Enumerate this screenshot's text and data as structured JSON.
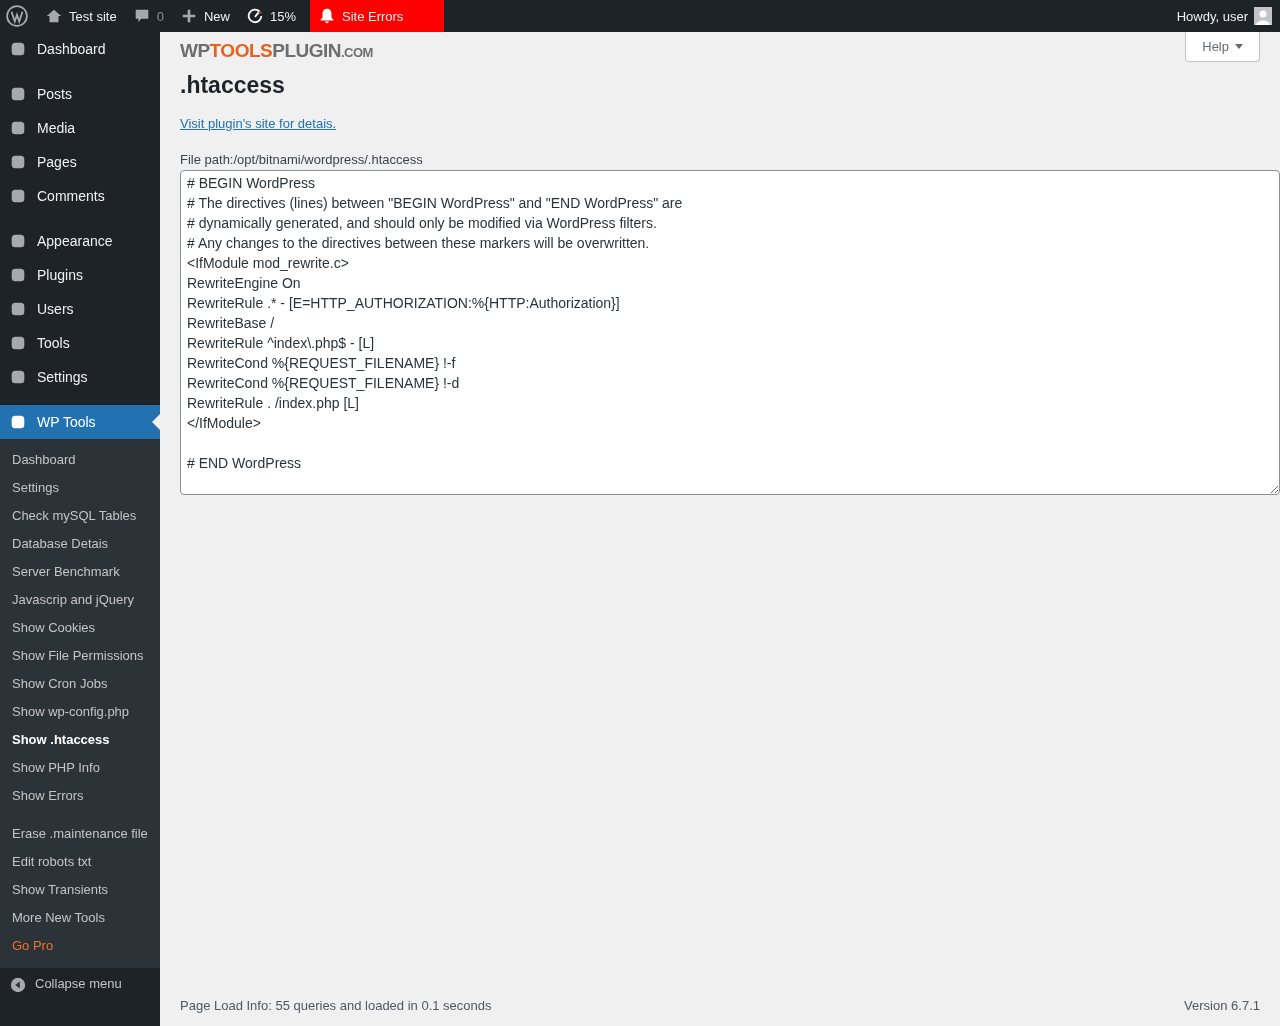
{
  "admin_bar": {
    "site": "Test site",
    "comments": "0",
    "new": "New",
    "speed": "15%",
    "alert": "Site Errors",
    "greeting": "Howdy, user"
  },
  "menu_groups": [
    {
      "items": [
        {
          "label": "Dashboard",
          "selected": false
        }
      ]
    },
    {
      "items": [
        {
          "label": "Posts",
          "selected": false
        },
        {
          "label": "Media",
          "selected": false
        },
        {
          "label": "Pages",
          "selected": false
        },
        {
          "label": "Comments",
          "selected": false
        }
      ]
    },
    {
      "items": [
        {
          "label": "Appearance",
          "selected": false
        },
        {
          "label": "Plugins",
          "selected": false
        },
        {
          "label": "Users",
          "selected": false
        },
        {
          "label": "Tools",
          "selected": false
        },
        {
          "label": "Settings",
          "selected": false
        }
      ]
    },
    {
      "items": [
        {
          "label": "WP Tools",
          "selected": true
        }
      ]
    }
  ],
  "submenu_groups": [
    {
      "items": [
        {
          "label": "Dashboard",
          "kind": "link",
          "selected": false
        },
        {
          "label": "Settings",
          "kind": "link",
          "selected": false
        },
        {
          "label": "Check mySQL Tables",
          "kind": "link",
          "selected": false
        },
        {
          "label": "Database Detais",
          "kind": "link",
          "selected": false
        },
        {
          "label": "Server Benchmark",
          "kind": "link",
          "selected": false
        },
        {
          "label": "Javascrip and jQuery",
          "kind": "link",
          "selected": false
        },
        {
          "label": "Show Cookies",
          "kind": "link",
          "selected": false
        },
        {
          "label": "Show File Permissions",
          "kind": "link",
          "selected": false
        },
        {
          "label": "Show Cron Jobs",
          "kind": "link",
          "selected": false
        },
        {
          "label": "Show wp-config.php",
          "kind": "link",
          "selected": false
        },
        {
          "label": "Show .htaccess",
          "kind": "link",
          "selected": true
        },
        {
          "label": "Show PHP Info",
          "kind": "link",
          "selected": false
        },
        {
          "label": "Show Errors",
          "kind": "link",
          "selected": false
        }
      ]
    },
    {
      "items": [
        {
          "label": "Erase .maintenance file",
          "kind": "link",
          "selected": false
        },
        {
          "label": "Edit robots txt",
          "kind": "link",
          "selected": false
        },
        {
          "label": "Show Transients",
          "kind": "link",
          "selected": false
        },
        {
          "label": "More New Tools",
          "kind": "link",
          "selected": false
        },
        {
          "label": "Go Pro",
          "kind": "pro",
          "selected": false
        }
      ]
    }
  ],
  "collapse": "Collapse menu",
  "logo": {
    "part_1": "WP",
    "part_2": "TOOLS",
    "part_3": "PLUGIN",
    "part_4": ".COM"
  },
  "help": "Help",
  "title": ".htaccess",
  "link": "Visit plugin's site for detais.",
  "file_path": "File path:/opt/bitnami/wordpress/.htaccess",
  "file_content": "# BEGIN WordPress\n# The directives (lines) between \"BEGIN WordPress\" and \"END WordPress\" are\n# dynamically generated, and should only be modified via WordPress filters.\n# Any changes to the directives between these markers will be overwritten.\n<IfModule mod_rewrite.c>\nRewriteEngine On\nRewriteRule .* - [E=HTTP_AUTHORIZATION:%{HTTP:Authorization}]\nRewriteBase /\nRewriteRule ^index\\.php$ - [L]\nRewriteCond %{REQUEST_FILENAME} !-f\nRewriteCond %{REQUEST_FILENAME} !-d\nRewriteRule . /index.php [L]\n</IfModule>\n\n# END WordPress",
  "footer": {
    "info": "Page Load Info: 55 queries and loaded in 0.1 seconds",
    "version": "Version 6.7.1"
  }
}
